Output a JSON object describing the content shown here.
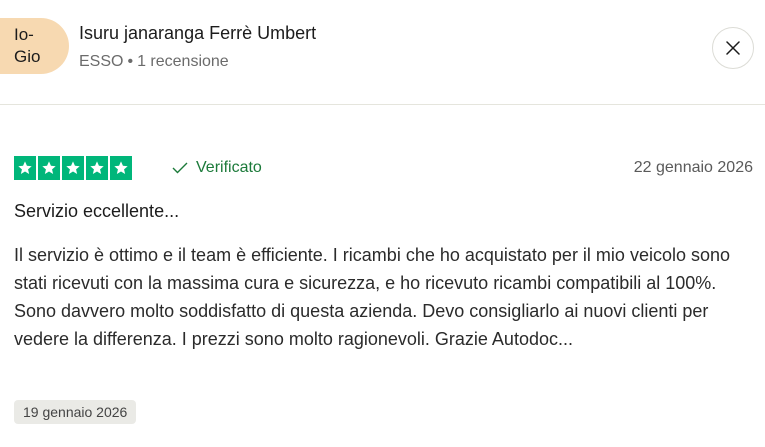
{
  "reviewer": {
    "avatar_text": "Io-\nGio",
    "name": "Isuru janaranga Ferrè Umbert",
    "country": "ESSO",
    "separator": "•",
    "review_count": "1 recensione"
  },
  "review": {
    "rating": 5,
    "verified_label": "Verificato",
    "date": "22 gennaio 2026",
    "title": "Servizio eccellente...",
    "body": "Il servizio è ottimo e il team è efficiente. I ricambi che ho acquistato per il mio veicolo sono stati ricevuti con la massima cura e sicurezza, e ho ricevuto ricambi compatibili al 100%. Sono davvero molto soddisfatto di questa azienda. Devo consigliarlo ai nuovi clienti per vedere la differenza. I prezzi sono molto ragionevoli. Grazie Autodoc...",
    "experience_date": "19 gennaio 2026"
  },
  "icons": {
    "close": "close-icon",
    "star": "star-icon",
    "check": "check-icon"
  },
  "colors": {
    "star_green": "#00b67a",
    "verified_green": "#1c7a3a",
    "avatar_bg": "#f7d9b1"
  }
}
